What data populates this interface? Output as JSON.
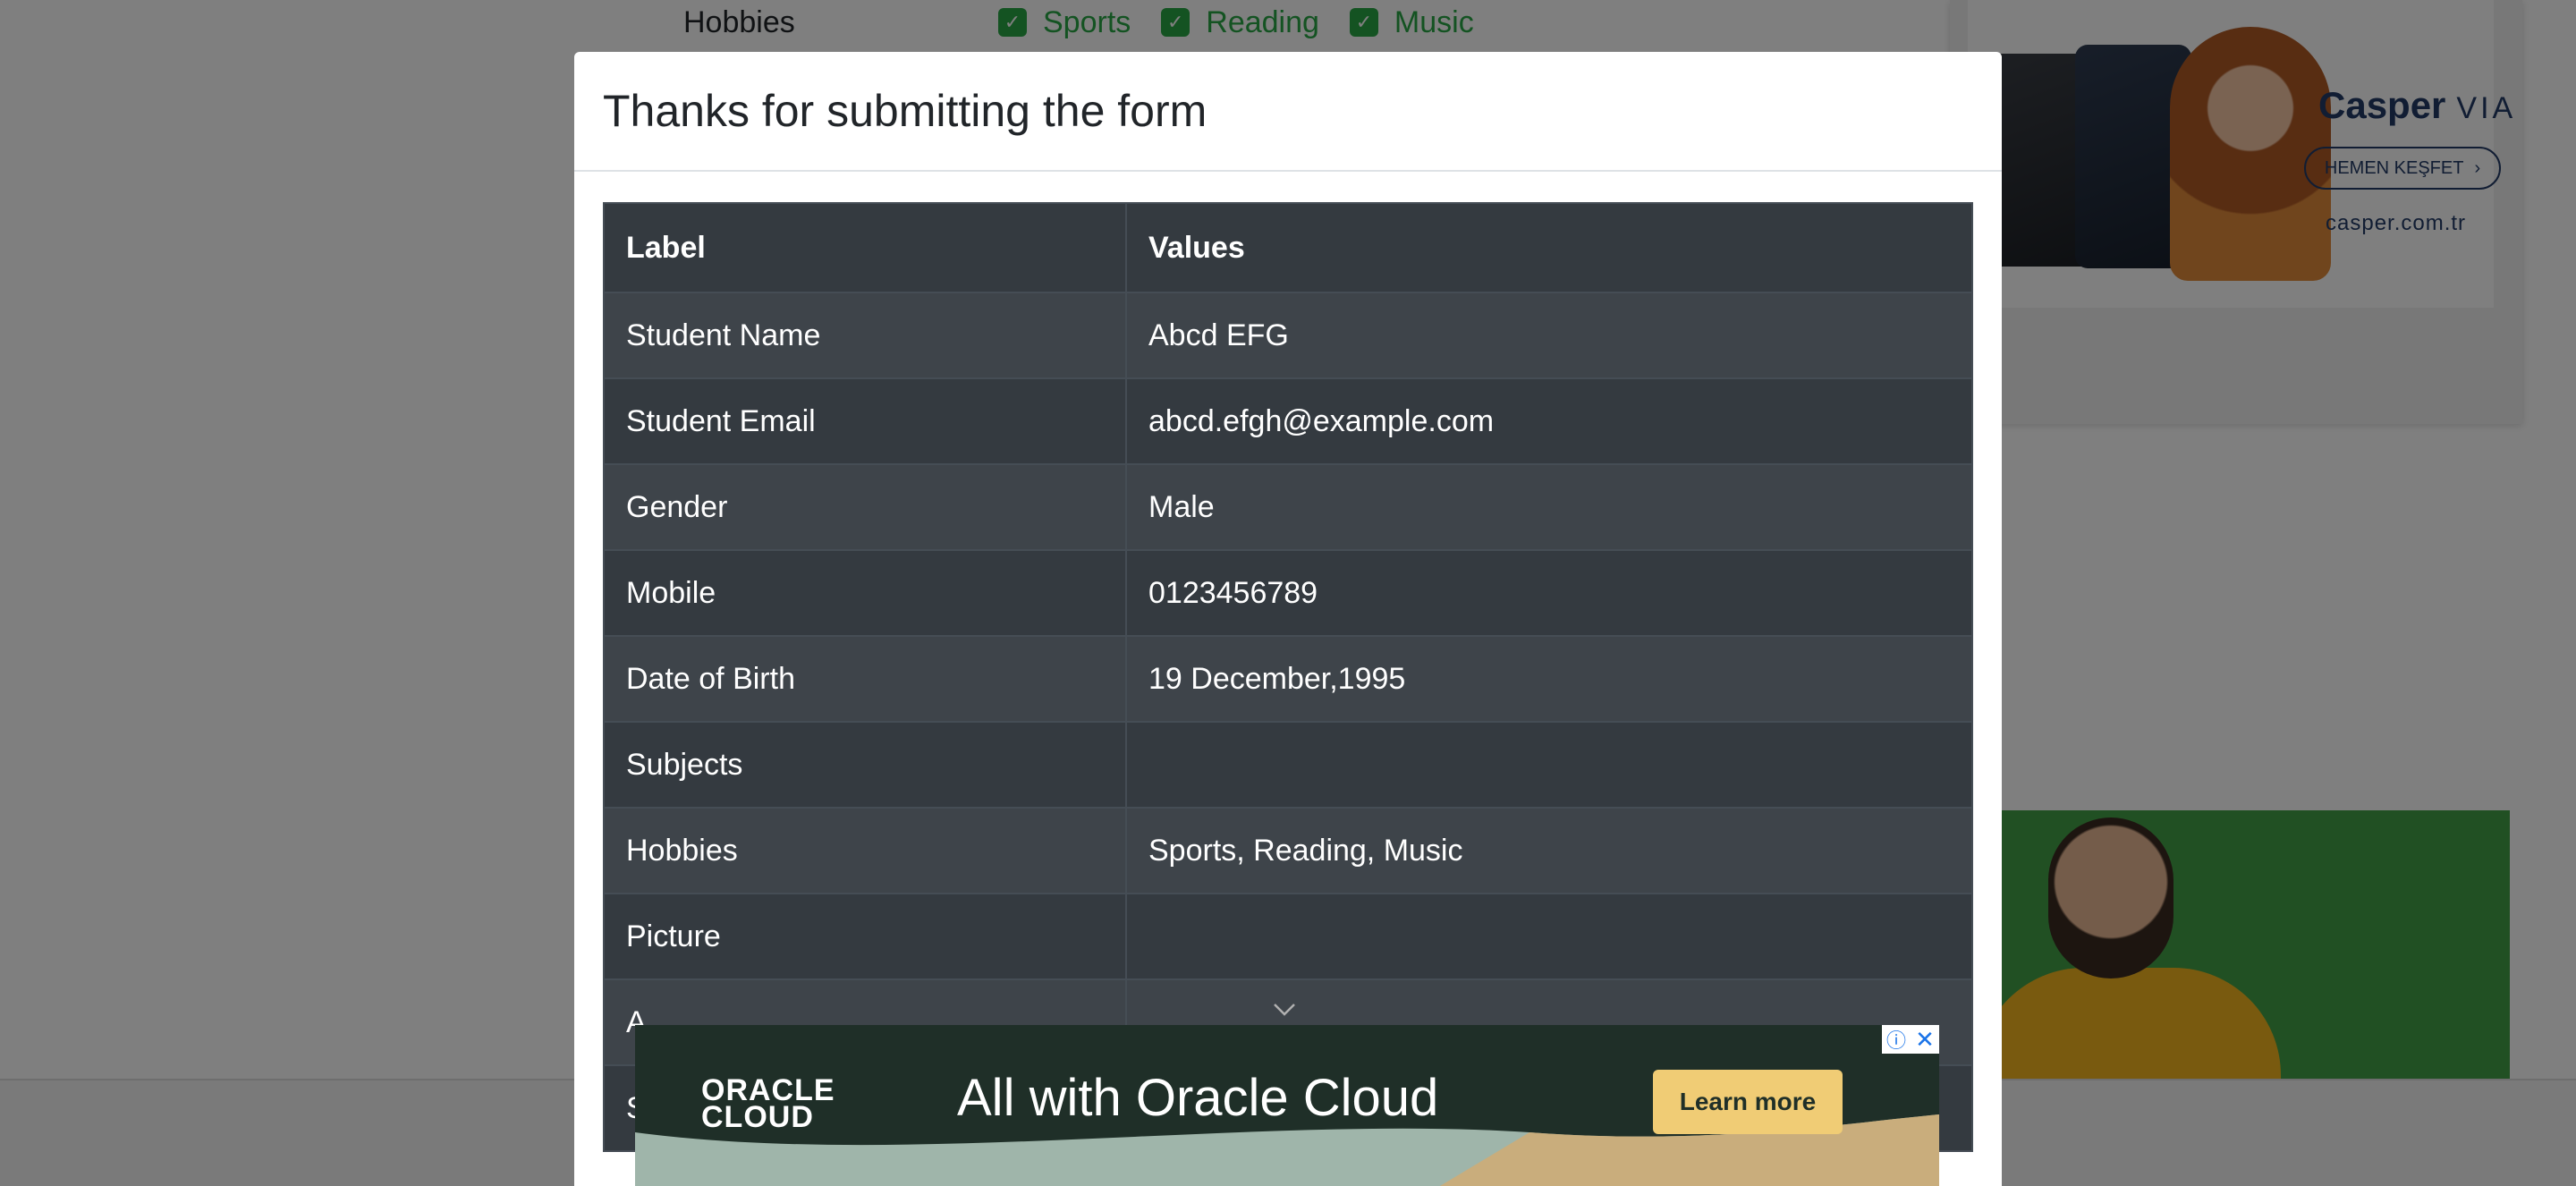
{
  "background": {
    "hobbies_label": "Hobbies",
    "hobbies_options": [
      "Sports",
      "Reading",
      "Music"
    ]
  },
  "ads": {
    "casper": {
      "brand": "Casper",
      "brand_suffix": "VIA",
      "cta": "HEMEN KEŞFET",
      "url": "casper.com.tr"
    },
    "oracle": {
      "logo_line1": "ORACLE",
      "logo_line2": "CLOUD",
      "headline": "All with Oracle Cloud",
      "cta": "Learn more",
      "adchoices_glyph": "ⓘ",
      "close_glyph": "✕"
    }
  },
  "modal": {
    "title": "Thanks for submitting the form",
    "table": {
      "headers": [
        "Label",
        "Values"
      ],
      "rows": [
        {
          "label": "Student Name",
          "value": "Abcd EFG"
        },
        {
          "label": "Student Email",
          "value": "abcd.efgh@example.com"
        },
        {
          "label": "Gender",
          "value": "Male"
        },
        {
          "label": "Mobile",
          "value": "0123456789"
        },
        {
          "label": "Date of Birth",
          "value": "19 December,1995"
        },
        {
          "label": "Subjects",
          "value": ""
        },
        {
          "label": "Hobbies",
          "value": "Sports, Reading, Music"
        },
        {
          "label": "Picture",
          "value": ""
        },
        {
          "label": "A",
          "value": ""
        },
        {
          "label": "S",
          "value": ""
        }
      ]
    }
  }
}
